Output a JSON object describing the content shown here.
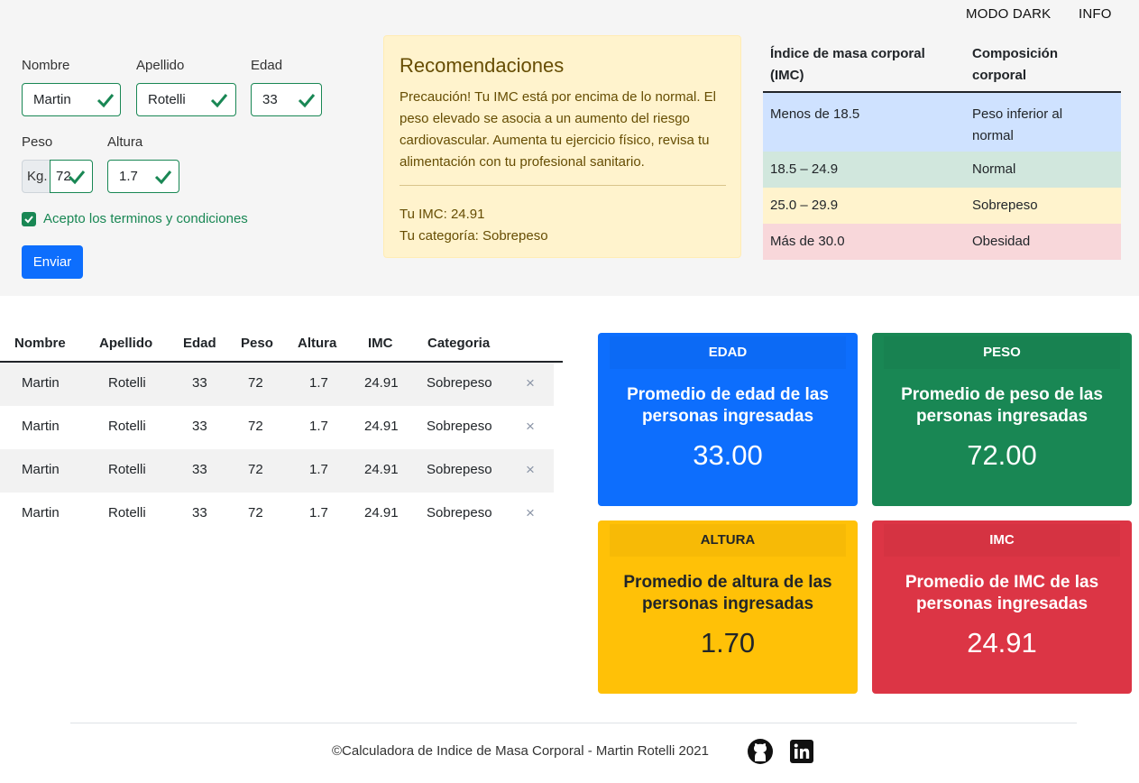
{
  "nav": {
    "dark_mode": "MODO DARK",
    "info": "INFO"
  },
  "form": {
    "nombre_label": "Nombre",
    "nombre_value": "Martin",
    "apellido_label": "Apellido",
    "apellido_value": "Rotelli",
    "edad_label": "Edad",
    "edad_value": "33",
    "peso_label": "Peso",
    "peso_prefix": "Kg.",
    "peso_value": "72",
    "altura_label": "Altura",
    "altura_value": "1.7",
    "terms_label": "Acepto los terminos y condiciones",
    "submit_label": "Enviar"
  },
  "recommendations": {
    "title": "Recomendaciones",
    "text": "Precaución! Tu IMC está por encima de lo normal. El peso elevado se asocia a un aumento del riesgo cardiovascular. Aumenta tu ejercicio físico, revisa tu alimentación con tu profesional sanitario.",
    "imc_line": "Tu IMC: 24.91",
    "category_line": "Tu categoría: Sobrepeso"
  },
  "imc_table": {
    "headers": [
      "Índice de masa corporal (IMC)",
      "Composición corporal"
    ],
    "rows": [
      {
        "range": "Menos de 18.5",
        "label": "Peso inferior al normal",
        "color": "#cfe2ff"
      },
      {
        "range": "18.5 – 24.9",
        "label": "Normal",
        "color": "#d1e7dd"
      },
      {
        "range": "25.0 – 29.9",
        "label": "Sobrepeso",
        "color": "#fff3cd"
      },
      {
        "range": "Más de 30.0",
        "label": "Obesidad",
        "color": "#f8d7da"
      }
    ]
  },
  "people_table": {
    "headers": [
      "Nombre",
      "Apellido",
      "Edad",
      "Peso",
      "Altura",
      "IMC",
      "Categoria"
    ],
    "rows": [
      [
        "Martin",
        "Rotelli",
        "33",
        "72",
        "1.7",
        "24.91",
        "Sobrepeso"
      ],
      [
        "Martin",
        "Rotelli",
        "33",
        "72",
        "1.7",
        "24.91",
        "Sobrepeso"
      ],
      [
        "Martin",
        "Rotelli",
        "33",
        "72",
        "1.7",
        "24.91",
        "Sobrepeso"
      ],
      [
        "Martin",
        "Rotelli",
        "33",
        "72",
        "1.7",
        "24.91",
        "Sobrepeso"
      ]
    ],
    "delete_glyph": "×"
  },
  "stats": {
    "edad": {
      "header": "EDAD",
      "title": "Promedio de edad de las personas ingresadas",
      "value": "33.00",
      "color": "#0d6efd"
    },
    "peso": {
      "header": "PESO",
      "title": "Promedio de peso de las personas ingresadas",
      "value": "72.00",
      "color": "#198754"
    },
    "altura": {
      "header": "ALTURA",
      "title": "Promedio de altura de las personas ingresadas",
      "value": "1.70",
      "color": "#ffc107"
    },
    "imc": {
      "header": "IMC",
      "title": "Promedio de IMC de las personas ingresadas",
      "value": "24.91",
      "color": "#dc3545"
    }
  },
  "footer": {
    "text": "©Calculadora de Indice de Masa Corporal - Martin Rotelli 2021",
    "icons": [
      "github-icon",
      "linkedin-icon"
    ]
  }
}
